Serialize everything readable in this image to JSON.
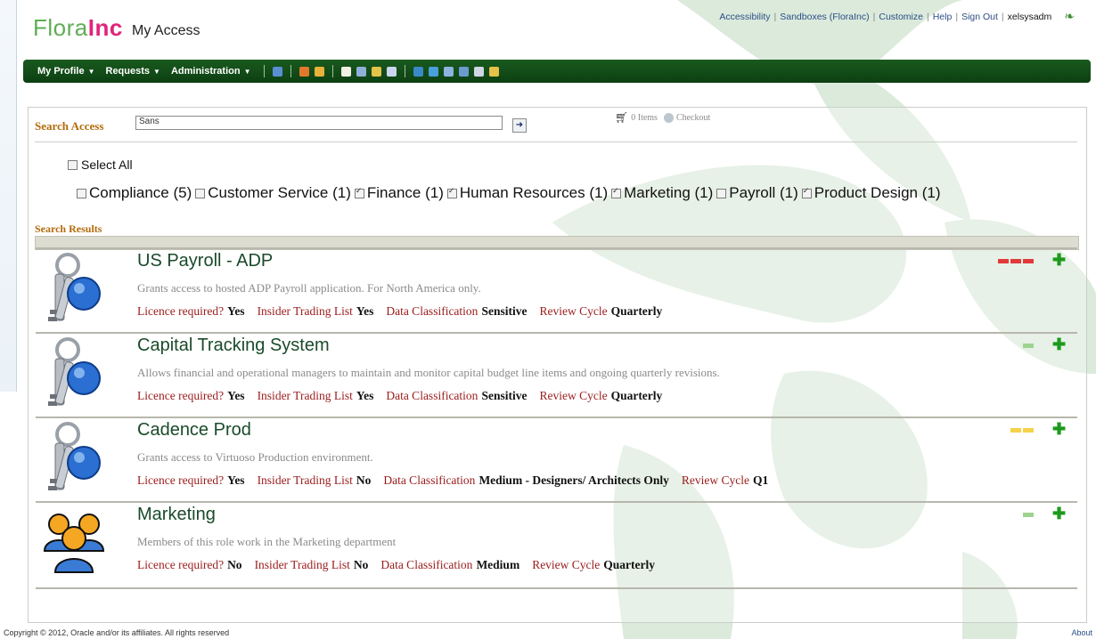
{
  "header": {
    "logo_part1": "Flora",
    "logo_part2": "Inc",
    "app_title": "My Access",
    "links": [
      "Accessibility",
      "Sandboxes (FloraInc)",
      "Customize",
      "Help",
      "Sign Out"
    ],
    "user": "xelsysadm"
  },
  "nav": {
    "menus": [
      "My Profile",
      "Requests",
      "Administration"
    ]
  },
  "search": {
    "label": "Search Access",
    "value": "Sans",
    "cart_text": "0 Items",
    "checkout_text": "Checkout"
  },
  "filters": {
    "select_all": "Select All",
    "items": [
      {
        "label": "Compliance (5)",
        "checked": false
      },
      {
        "label": "Customer Service (1)",
        "checked": false
      },
      {
        "label": "Finance (1)",
        "checked": true
      },
      {
        "label": "Human Resources (1)",
        "checked": true
      },
      {
        "label": "Marketing (1)",
        "checked": true
      },
      {
        "label": "Payroll (1)",
        "checked": false
      },
      {
        "label": "Product Design (1)",
        "checked": true
      }
    ]
  },
  "results": {
    "label": "Search Results",
    "meta_labels": {
      "licence": "Licence required?",
      "insider": "Insider Trading List",
      "classification": "Data Classification",
      "review": "Review Cycle"
    },
    "items": [
      {
        "title": "US Payroll - ADP",
        "description": "Grants access to hosted ADP Payroll application. For North America only.",
        "licence": "Yes",
        "insider": "Yes",
        "classification": "Sensitive",
        "review": "Quarterly",
        "icon": "keys-icon",
        "risk_color": "#e03a3a",
        "risk_bars": 3
      },
      {
        "title": "Capital Tracking System",
        "description": "Allows financial and operational managers to maintain and monitor capital budget line items and ongoing quarterly revisions.",
        "licence": "Yes",
        "insider": "Yes",
        "classification": "Sensitive",
        "review": "Quarterly",
        "icon": "keys-icon",
        "risk_color": "#9ed38e",
        "risk_bars": 1
      },
      {
        "title": "Cadence Prod",
        "description": "Grants access to Virtuoso Production environment.",
        "licence": "Yes",
        "insider": "No",
        "classification": "Medium - Designers/ Architects Only",
        "review": "Q1",
        "icon": "keys-icon",
        "risk_color": "#f5d24a",
        "risk_bars": 2
      },
      {
        "title": "Marketing",
        "description": "Members of this role work in the Marketing department",
        "licence": "No",
        "insider": "No",
        "classification": "Medium",
        "review": "Quarterly",
        "icon": "people-icon",
        "risk_color": "#9ed38e",
        "risk_bars": 1
      }
    ]
  },
  "footer": {
    "copyright": "Copyright © 2012, Oracle and/or its affiliates. All rights reserved",
    "about": "About"
  },
  "colors": {
    "nav_green": "#0c3f12",
    "section_label": "#b36b0b",
    "meta_label": "#9a1b1b",
    "add_green": "#1c9a1c"
  }
}
